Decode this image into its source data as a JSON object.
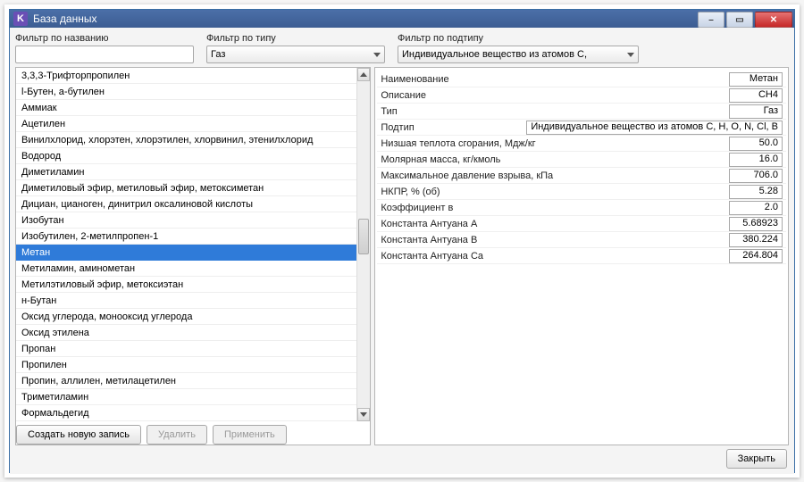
{
  "window": {
    "title": "База данных",
    "app_icon_letter": "K"
  },
  "filters": {
    "name": {
      "label": "Фильтр по названию",
      "value": ""
    },
    "type": {
      "label": "Фильтр по типу",
      "selected": "Газ"
    },
    "subtype": {
      "label": "Фильтр по подтипу",
      "selected": "Индивидуальное вещество из атомов C,"
    }
  },
  "list": {
    "items": [
      "3,3,3-Трифторпропилен",
      "l-Бутен, а-бутилен",
      "Аммиак",
      "Ацетилен",
      "Винилхлорид, хлорэтен, хлорэтилен, хлорвинил, этенилхлорид",
      "Водород",
      "Диметиламин",
      "Диметиловый эфир, метиловый эфир, метоксиметан",
      "Дициан, цианоген, динитрил оксалиновой кислоты",
      "Изобутан",
      "Изобутилен, 2-метилпропен-1",
      "Метан",
      "Метиламин, аминометан",
      "Метилэтиловый эфир, метоксиэтан",
      "н-Бутан",
      "Оксид углерода, монооксид углерода",
      "Оксид этилена",
      "Пропан",
      "Пропилен",
      "Пропин, аллилен, метилацетилен",
      "Триметиламин",
      "Формальдегид"
    ],
    "selected_index": 11
  },
  "details": {
    "rows": [
      {
        "label": "Наименование",
        "value": "Метан"
      },
      {
        "label": "Описание",
        "value": "CH4"
      },
      {
        "label": "Тип",
        "value": "Газ"
      },
      {
        "label": "Подтип",
        "value": "Индивидуальное вещество из атомов C, H, O, N, Cl, B",
        "wide": true
      },
      {
        "label": "Низшая теплота сгорания, Мдж/кг",
        "value": "50.0"
      },
      {
        "label": "Молярная масса, кг/кмоль",
        "value": "16.0"
      },
      {
        "label": "Максимальное давление взрыва, кПа",
        "value": "706.0"
      },
      {
        "label": "НКПР, % (об)",
        "value": "5.28"
      },
      {
        "label": "Коэффициент в",
        "value": "2.0"
      },
      {
        "label": "Константа Антуана A",
        "value": "5.68923"
      },
      {
        "label": "Константа Антуана B",
        "value": "380.224"
      },
      {
        "label": "Константа Антуана Ca",
        "value": "264.804"
      }
    ]
  },
  "buttons": {
    "create": "Создать новую запись",
    "delete": "Удалить",
    "apply": "Применить",
    "close": "Закрыть"
  }
}
